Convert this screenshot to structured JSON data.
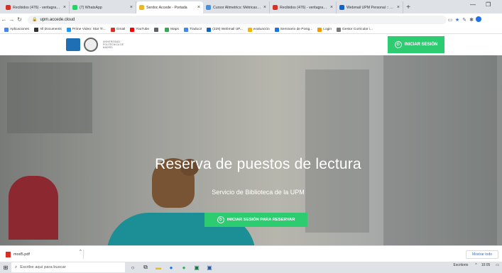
{
  "browser": {
    "tabs": [
      {
        "label": "Recibidos (476) - veritagran...",
        "color": "#d93025",
        "active": false
      },
      {
        "label": "(7) WhatsApp",
        "color": "#25d366",
        "active": false
      },
      {
        "label": "Serdoc Accede - Portada",
        "color": "#e8b923",
        "active": true
      },
      {
        "label": "Cursor Altmetrics: Métricas c...",
        "color": "#4a90d9",
        "active": false
      },
      {
        "label": "Recibidos (476) - veritagran...",
        "color": "#d93025",
        "active": false
      },
      {
        "label": "Webmail UPM Personal :: Re...",
        "color": "#1565c0",
        "active": false
      }
    ],
    "new_tab_symbol": "+",
    "url": "upm.accede.cloud",
    "bookmarks": [
      {
        "label": "Aplicaciones",
        "color": "#4285f4"
      },
      {
        "label": "All Documents",
        "color": "#333333"
      },
      {
        "label": "Prime Video: Star Tr...",
        "color": "#1a98ff"
      },
      {
        "label": "Gmail",
        "color": "#d93025"
      },
      {
        "label": "YouTube",
        "color": "#ff0000"
      },
      {
        "label": "",
        "color": "#5f6368"
      },
      {
        "label": "Maps",
        "color": "#34a853"
      },
      {
        "label": "Traducir",
        "color": "#4285f4"
      },
      {
        "label": "(229) Webmail UP...",
        "color": "#1565c0"
      },
      {
        "label": "evaluación",
        "color": "#f4b400"
      },
      {
        "label": "Seminario de Posig...",
        "color": "#1a73e8"
      },
      {
        "label": "Login",
        "color": "#f29900"
      },
      {
        "label": "Gestor Curricular i...",
        "color": "#7a7a7a"
      }
    ]
  },
  "site": {
    "university_name": "UNIVERSIDAD POLITÉCNICA DE MADRID",
    "login_label": "INICIAR SESIÓN",
    "hero_title": "Reserva de puestos de lectura",
    "hero_subtitle": "Servicio de Biblioteca de la UPM",
    "reserve_label": "INICIAR SESIÓN PARA RESERVAR",
    "accent_color": "#2ecc71"
  },
  "downloads": {
    "file_name": "mod5.pdf",
    "show_all_label": "Mostrar todo"
  },
  "taskbar": {
    "search_placeholder": "Escribe aquí para buscar",
    "tray_text": "Escritorio",
    "time": "10:05"
  }
}
